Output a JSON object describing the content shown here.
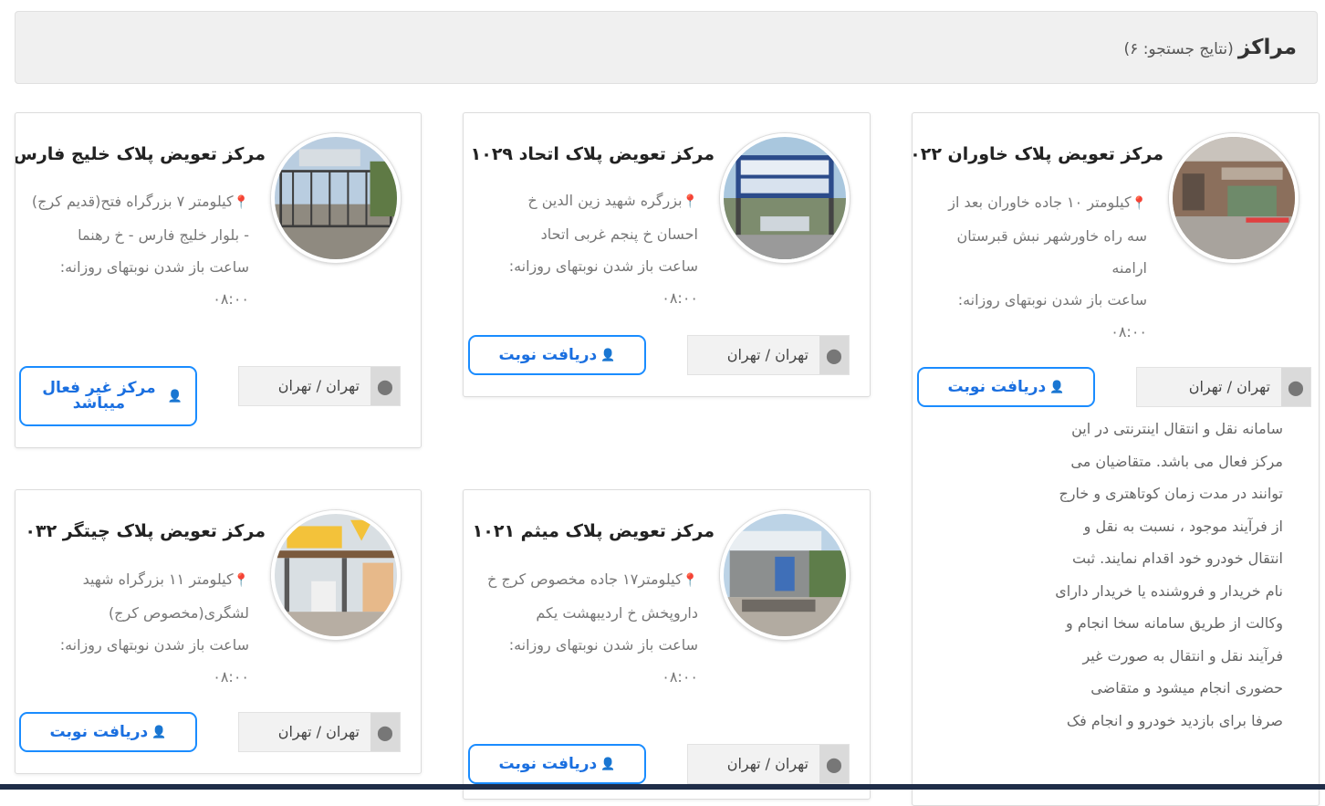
{
  "header": {
    "title": "مراکز",
    "count_text": "(نتایج جستجو: ۶)"
  },
  "cards": [
    {
      "title": "مرکز تعویض پلاک خاوران ۰۲۲",
      "address": "کیلومتر ۱۰ جاده خاوران بعد از سه راه خاورشهر نبش قبرستان ارامنه",
      "hours_label": "ساعت باز شدن نوبتهای روزانه:",
      "hours_value": "۰۸:۰۰",
      "location": "تهران / تهران",
      "button_label": "دریافت نوبت",
      "description": "سامانه نقل و انتقال اینترنتی در این مرکز فعال می باشد. متقاضیان می توانند در مدت زمان کوتاهتری و خارج از فرآیند موجود ، نسبت به نقل و انتقال خودرو خود اقدام نمایند. ثبت نام خریدار و فروشنده یا خریدار دارای وکالت از طریق سامانه سخا انجام و فرآیند نقل و انتقال به صورت غیر حضوری انجام میشود و متقاضی صرفا برای بازدید خودرو و انجام فک"
    },
    {
      "title": "مرکز تعویض پلاک اتحاد ۱۰۲۹",
      "address": "بزرگره شهید زین الدین خ احسان خ پنجم غربی اتحاد",
      "hours_label": "ساعت باز شدن نوبتهای روزانه:",
      "hours_value": "۰۸:۰۰",
      "location": "تهران / تهران",
      "button_label": "دریافت نوبت"
    },
    {
      "title": "مرکز تعویض پلاک خلیج فارس",
      "address": "کیلومتر ۷ بزرگراه فتح(قدیم کرج) - بلوار خلیج فارس - خ رهنما",
      "hours_label": "ساعت باز شدن نوبتهای روزانه:",
      "hours_value": "۰۸:۰۰",
      "location": "تهران / تهران",
      "button_label": "مرکز غیر فعال میباشد"
    },
    {
      "title": "مرکز تعویض پلاک میثم ۱۰۲۱",
      "address": "کیلومتر۱۷ جاده مخصوص کرج خ داروپخش خ اردیبهشت یکم",
      "hours_label": "ساعت باز شدن نوبتهای روزانه:",
      "hours_value": "۰۸:۰۰",
      "location": "تهران / تهران",
      "button_label": "دریافت نوبت"
    },
    {
      "title": "مرکز تعویض پلاک چیتگر ۰۳۲",
      "address": "کیلومتر ۱۱ بزرگراه شهید لشگری(مخصوص کرج)",
      "hours_label": "ساعت باز شدن نوبتهای روزانه:",
      "hours_value": "۰۸:۰۰",
      "location": "تهران / تهران",
      "button_label": "دریافت نوبت"
    }
  ],
  "icons": {
    "pin": "map-marker-icon",
    "user": "user-icon"
  },
  "colors": {
    "accent": "#1a8cff",
    "header_bg": "#f0f0f0"
  }
}
